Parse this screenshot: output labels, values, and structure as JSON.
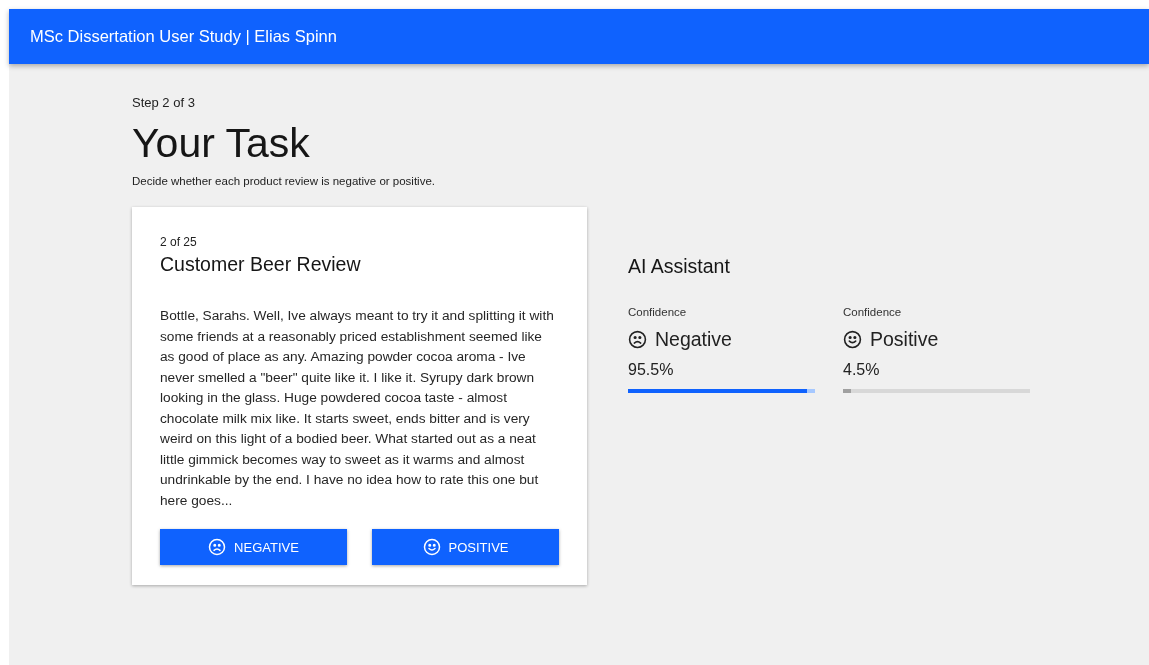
{
  "header": {
    "title": "MSc Dissertation User Study | Elias Spinn"
  },
  "step": "Step 2 of 3",
  "heading": "Your Task",
  "instructions": "Decide whether each product review is negative or positive.",
  "review_card": {
    "counter": "2 of 25",
    "title": "Customer Beer Review",
    "text": "Bottle, Sarahs. Well, Ive always meant to try it and splitting it with some friends at a reasonably priced establishment seemed like as good of place as any. Amazing powder cocoa aroma - Ive never smelled a \"beer\" quite like it. I like it. Syrupy dark brown looking in the glass. Huge powdered cocoa taste - almost chocolate milk mix like. It starts sweet, ends bitter and is very weird on this light of a bodied beer. What started out as a neat little gimmick becomes way to sweet as it warms and almost undrinkable by the end. I have no idea how to rate this one but here goes...",
    "buttons": [
      {
        "kind": "negative",
        "label": "NEGATIVE"
      },
      {
        "kind": "positive",
        "label": "POSITIVE"
      }
    ]
  },
  "assistant": {
    "title": "AI Assistant",
    "predictions": [
      {
        "kind": "negative",
        "caption": "Confidence",
        "label": "Negative",
        "reading": "95.5%",
        "level": 0.955,
        "selected": true
      },
      {
        "kind": "positive",
        "caption": "Confidence",
        "label": "Positive",
        "reading": "4.5%",
        "level": 0.045,
        "selected": false
      }
    ]
  }
}
